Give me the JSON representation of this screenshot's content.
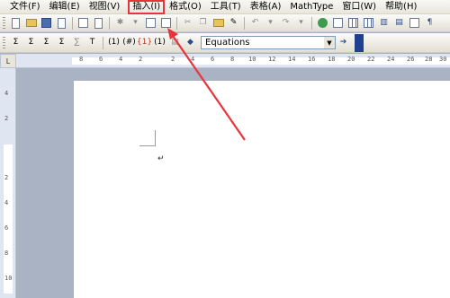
{
  "menu": [
    {
      "key": "file",
      "label": "文件(F)"
    },
    {
      "key": "edit",
      "label": "编辑(E)"
    },
    {
      "key": "view",
      "label": "视图(V)"
    },
    {
      "key": "insert",
      "label": "插入(I)"
    },
    {
      "key": "format",
      "label": "格式(O)"
    },
    {
      "key": "tools",
      "label": "工具(T)"
    },
    {
      "key": "table",
      "label": "表格(A)"
    },
    {
      "key": "mathtype",
      "label": "MathType"
    },
    {
      "key": "window",
      "label": "窗口(W)"
    },
    {
      "key": "help",
      "label": "帮助(H)"
    }
  ],
  "mathtype_toolbar": {
    "equation_numbers": [
      "(1)",
      "(#)",
      "{1}",
      "(1)"
    ],
    "dropdown_value": "Equations"
  },
  "ruler": {
    "corner": "L",
    "top_numbers": [
      "8",
      "6",
      "4",
      "2",
      "2",
      "4",
      "6",
      "8",
      "10",
      "12",
      "14",
      "16",
      "18",
      "20",
      "22",
      "24",
      "26",
      "28",
      "30"
    ],
    "left_numbers": [
      "4",
      "2",
      "2",
      "4",
      "6",
      "8",
      "10"
    ]
  },
  "document": {
    "paragraph_mark": "↵"
  },
  "annotation_color": "#e8343b"
}
